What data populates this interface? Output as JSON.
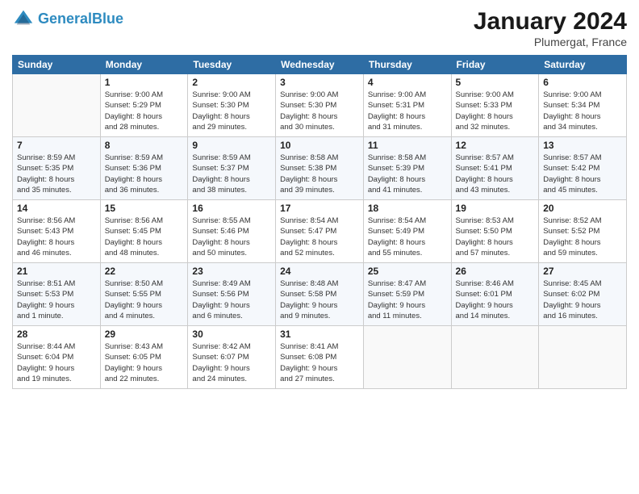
{
  "header": {
    "logo_line1": "General",
    "logo_line2": "Blue",
    "month_title": "January 2024",
    "location": "Plumergat, France"
  },
  "days_of_week": [
    "Sunday",
    "Monday",
    "Tuesday",
    "Wednesday",
    "Thursday",
    "Friday",
    "Saturday"
  ],
  "weeks": [
    [
      {
        "day": "",
        "info": ""
      },
      {
        "day": "1",
        "info": "Sunrise: 9:00 AM\nSunset: 5:29 PM\nDaylight: 8 hours\nand 28 minutes."
      },
      {
        "day": "2",
        "info": "Sunrise: 9:00 AM\nSunset: 5:30 PM\nDaylight: 8 hours\nand 29 minutes."
      },
      {
        "day": "3",
        "info": "Sunrise: 9:00 AM\nSunset: 5:30 PM\nDaylight: 8 hours\nand 30 minutes."
      },
      {
        "day": "4",
        "info": "Sunrise: 9:00 AM\nSunset: 5:31 PM\nDaylight: 8 hours\nand 31 minutes."
      },
      {
        "day": "5",
        "info": "Sunrise: 9:00 AM\nSunset: 5:33 PM\nDaylight: 8 hours\nand 32 minutes."
      },
      {
        "day": "6",
        "info": "Sunrise: 9:00 AM\nSunset: 5:34 PM\nDaylight: 8 hours\nand 34 minutes."
      }
    ],
    [
      {
        "day": "7",
        "info": "Sunrise: 8:59 AM\nSunset: 5:35 PM\nDaylight: 8 hours\nand 35 minutes."
      },
      {
        "day": "8",
        "info": "Sunrise: 8:59 AM\nSunset: 5:36 PM\nDaylight: 8 hours\nand 36 minutes."
      },
      {
        "day": "9",
        "info": "Sunrise: 8:59 AM\nSunset: 5:37 PM\nDaylight: 8 hours\nand 38 minutes."
      },
      {
        "day": "10",
        "info": "Sunrise: 8:58 AM\nSunset: 5:38 PM\nDaylight: 8 hours\nand 39 minutes."
      },
      {
        "day": "11",
        "info": "Sunrise: 8:58 AM\nSunset: 5:39 PM\nDaylight: 8 hours\nand 41 minutes."
      },
      {
        "day": "12",
        "info": "Sunrise: 8:57 AM\nSunset: 5:41 PM\nDaylight: 8 hours\nand 43 minutes."
      },
      {
        "day": "13",
        "info": "Sunrise: 8:57 AM\nSunset: 5:42 PM\nDaylight: 8 hours\nand 45 minutes."
      }
    ],
    [
      {
        "day": "14",
        "info": "Sunrise: 8:56 AM\nSunset: 5:43 PM\nDaylight: 8 hours\nand 46 minutes."
      },
      {
        "day": "15",
        "info": "Sunrise: 8:56 AM\nSunset: 5:45 PM\nDaylight: 8 hours\nand 48 minutes."
      },
      {
        "day": "16",
        "info": "Sunrise: 8:55 AM\nSunset: 5:46 PM\nDaylight: 8 hours\nand 50 minutes."
      },
      {
        "day": "17",
        "info": "Sunrise: 8:54 AM\nSunset: 5:47 PM\nDaylight: 8 hours\nand 52 minutes."
      },
      {
        "day": "18",
        "info": "Sunrise: 8:54 AM\nSunset: 5:49 PM\nDaylight: 8 hours\nand 55 minutes."
      },
      {
        "day": "19",
        "info": "Sunrise: 8:53 AM\nSunset: 5:50 PM\nDaylight: 8 hours\nand 57 minutes."
      },
      {
        "day": "20",
        "info": "Sunrise: 8:52 AM\nSunset: 5:52 PM\nDaylight: 8 hours\nand 59 minutes."
      }
    ],
    [
      {
        "day": "21",
        "info": "Sunrise: 8:51 AM\nSunset: 5:53 PM\nDaylight: 9 hours\nand 1 minute."
      },
      {
        "day": "22",
        "info": "Sunrise: 8:50 AM\nSunset: 5:55 PM\nDaylight: 9 hours\nand 4 minutes."
      },
      {
        "day": "23",
        "info": "Sunrise: 8:49 AM\nSunset: 5:56 PM\nDaylight: 9 hours\nand 6 minutes."
      },
      {
        "day": "24",
        "info": "Sunrise: 8:48 AM\nSunset: 5:58 PM\nDaylight: 9 hours\nand 9 minutes."
      },
      {
        "day": "25",
        "info": "Sunrise: 8:47 AM\nSunset: 5:59 PM\nDaylight: 9 hours\nand 11 minutes."
      },
      {
        "day": "26",
        "info": "Sunrise: 8:46 AM\nSunset: 6:01 PM\nDaylight: 9 hours\nand 14 minutes."
      },
      {
        "day": "27",
        "info": "Sunrise: 8:45 AM\nSunset: 6:02 PM\nDaylight: 9 hours\nand 16 minutes."
      }
    ],
    [
      {
        "day": "28",
        "info": "Sunrise: 8:44 AM\nSunset: 6:04 PM\nDaylight: 9 hours\nand 19 minutes."
      },
      {
        "day": "29",
        "info": "Sunrise: 8:43 AM\nSunset: 6:05 PM\nDaylight: 9 hours\nand 22 minutes."
      },
      {
        "day": "30",
        "info": "Sunrise: 8:42 AM\nSunset: 6:07 PM\nDaylight: 9 hours\nand 24 minutes."
      },
      {
        "day": "31",
        "info": "Sunrise: 8:41 AM\nSunset: 6:08 PM\nDaylight: 9 hours\nand 27 minutes."
      },
      {
        "day": "",
        "info": ""
      },
      {
        "day": "",
        "info": ""
      },
      {
        "day": "",
        "info": ""
      }
    ]
  ]
}
